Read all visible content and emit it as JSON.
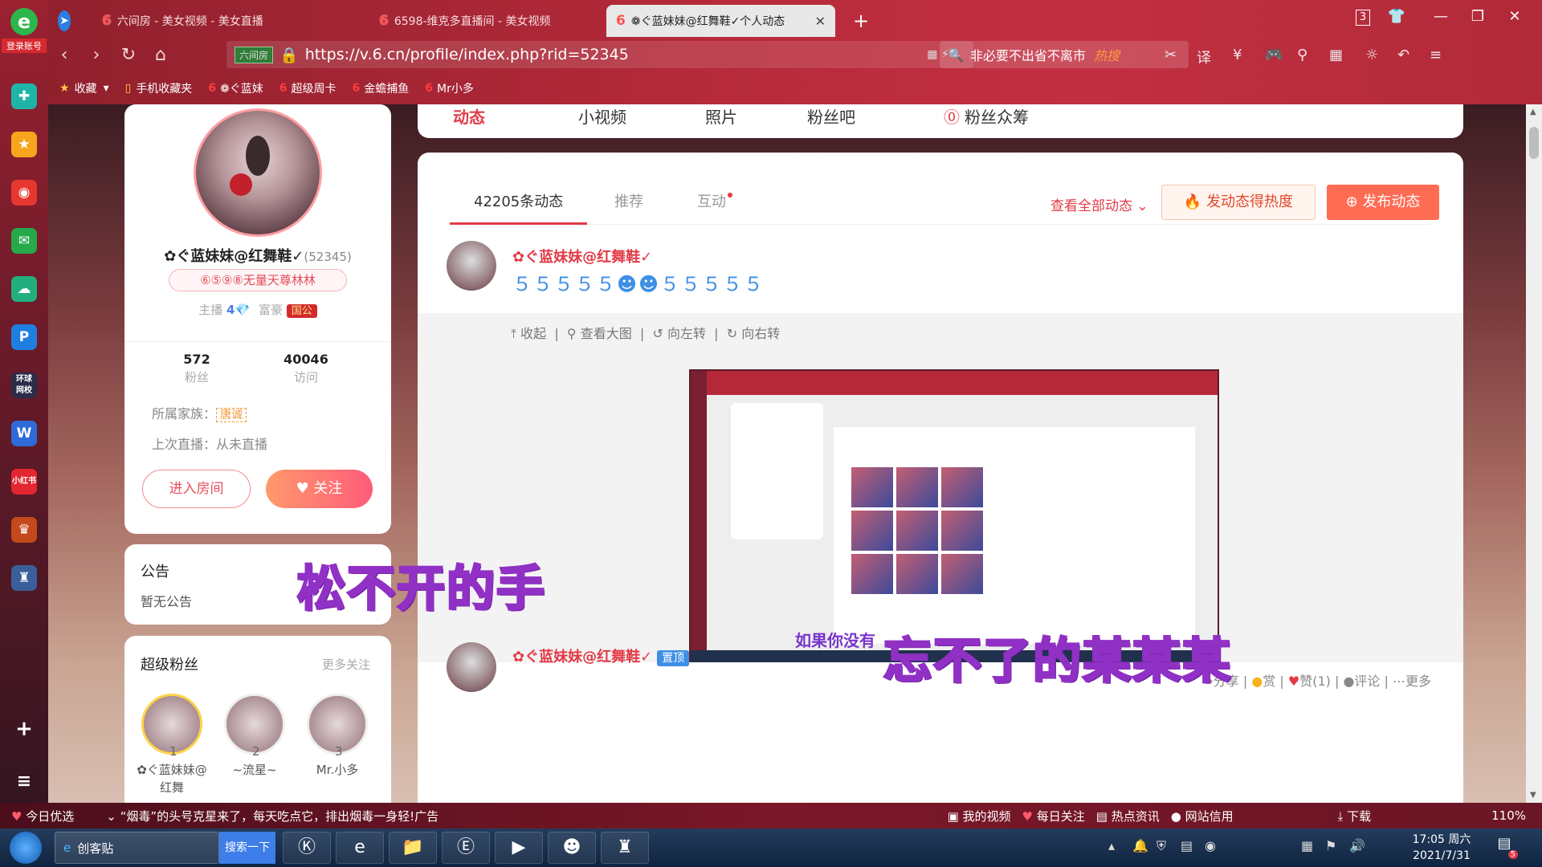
{
  "sidebar": {
    "login_label": "登录账号",
    "icons": [
      "app-plus",
      "star",
      "weibo",
      "mail",
      "cloud",
      "p-app",
      "news-app",
      "word-app",
      "xiaohongshu-app",
      "game-app",
      "game2-app"
    ],
    "add": "+",
    "menu": "≡"
  },
  "tabs": [
    {
      "label": "六间房 - 美女视频 - 美女直播"
    },
    {
      "label": "6598-维克多直播间 - 美女视频"
    },
    {
      "label": "❁ぐ蓝妹妹@红舞鞋✓个人动态"
    }
  ],
  "address": {
    "shield": "六间房",
    "url": "https://v.6.cn/profile/index.php?rid=52345"
  },
  "search": {
    "text": "非必要不出省不离市",
    "hot": "热搜"
  },
  "window": {
    "badge": "3"
  },
  "bookmarks": [
    {
      "label": "收藏"
    },
    {
      "label": "手机收藏夹"
    },
    {
      "label": "❁ぐ蓝妹"
    },
    {
      "label": "超级周卡"
    },
    {
      "label": "金蟾捕鱼"
    },
    {
      "label": "Mr小多"
    }
  ],
  "page_nav": {
    "tabs": [
      "动态",
      "小视频",
      "照片",
      "粉丝吧",
      "粉丝众筹"
    ]
  },
  "profile": {
    "name": "✿ぐ蓝妹妹@红舞鞋✓",
    "rid": "(52345)",
    "badge": "⑥⑤⑨⑧无量天尊林林",
    "anchor_label": "主播",
    "anchor_level": "4",
    "rich_label": "富豪",
    "rich_badge": "国公",
    "fans_value": "572",
    "fans_label": "粉丝",
    "visits_value": "40046",
    "visits_label": "访问",
    "family_label": "所属家族：",
    "family_tag": "唐诚",
    "last_live": "上次直播：从未直播",
    "enter_btn": "进入房间",
    "follow_btn": "关注"
  },
  "notice": {
    "title": "公告",
    "body": "暂无公告"
  },
  "superfans": {
    "title": "超级粉丝",
    "more": "更多关注",
    "fans": [
      {
        "rank": "1",
        "name": "✿ぐ蓝妹妹@红舞"
      },
      {
        "rank": "2",
        "name": "~流星~"
      },
      {
        "rank": "3",
        "name": "Mr.小多"
      }
    ]
  },
  "feed": {
    "tab_count": "42205条动态",
    "tab_rec": "推荐",
    "tab_inter": "互动",
    "view_all": "查看全部动态",
    "hot_btn": "发动态得热度",
    "pub_btn": "发布动态",
    "post1_user": "✿ぐ蓝妹妹@红舞鞋✓",
    "post1_icons": "５５５５５☻☻５５５５５",
    "act_collapse": "收起",
    "act_big": "查看大图",
    "act_left": "向左转",
    "act_right": "向右转",
    "foot_share": "分享",
    "foot_reward": "赏",
    "foot_like": "赞(1)",
    "foot_comment": "评论",
    "foot_more": "更多",
    "post2_user": "✿ぐ蓝妹妹@红舞鞋✓",
    "post2_pin": "置顶",
    "shot_caption": "如果你没有"
  },
  "overlays": {
    "line1": "松不开的手",
    "line2": "忘不了的某某某"
  },
  "newsbar": {
    "label": "今日优选",
    "headline": "“烟毒”的头号克星来了，每天吃点它，排出烟毒一身轻!",
    "ad": "广告",
    "items": [
      "我的视频",
      "每日关注",
      "热点资讯",
      "网站信用",
      "下载"
    ],
    "zoom": "110%"
  },
  "taskbar": {
    "app": "创客贴",
    "search": "搜索一下",
    "time": "17:05 周六",
    "date": "2021/7/31",
    "notif": "5"
  }
}
